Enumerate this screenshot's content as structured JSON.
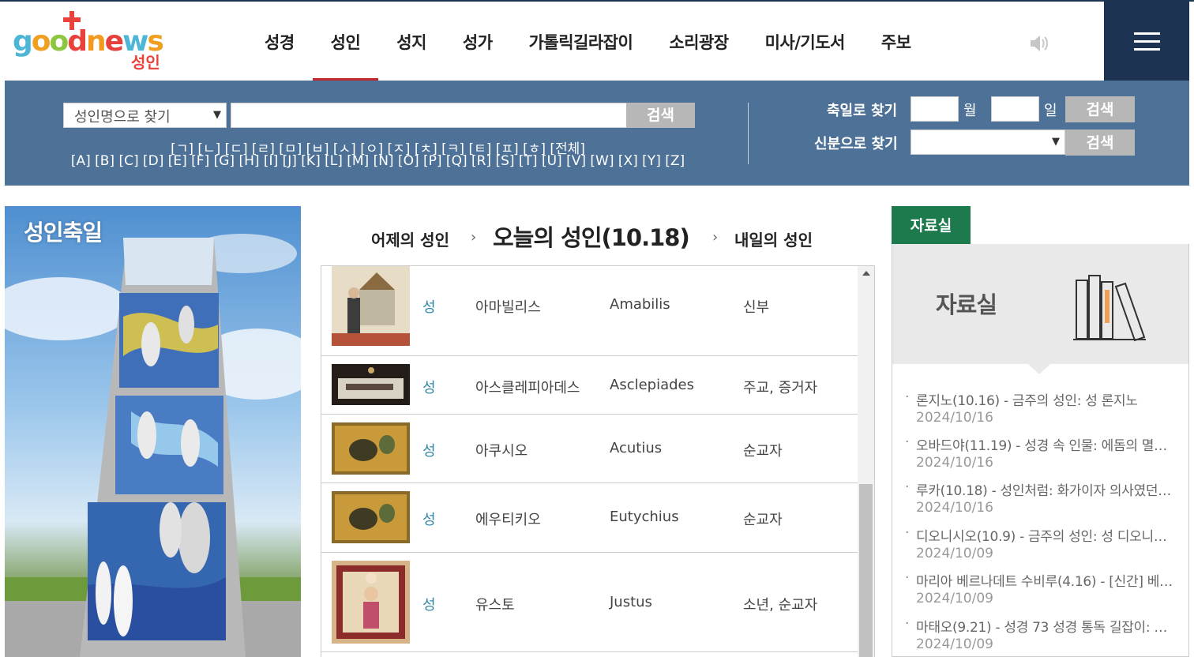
{
  "header": {
    "logo_text": "goodnews",
    "logo_sub": "성인",
    "nav": [
      {
        "label": "성경",
        "active": false
      },
      {
        "label": "성인",
        "active": true
      },
      {
        "label": "성지",
        "active": false
      },
      {
        "label": "성가",
        "active": false
      },
      {
        "label": "가톨릭길라잡이",
        "active": false
      },
      {
        "label": "소리광장",
        "active": false
      },
      {
        "label": "미사/기도서",
        "active": false
      },
      {
        "label": "주보",
        "active": false
      }
    ]
  },
  "search": {
    "select_value": "성인명으로 찾기",
    "button": "검색",
    "consonants": "[ㄱ] [ㄴ] [ㄷ] [ㄹ] [ㅁ] [ㅂ] [ㅅ] [ㅇ] [ㅈ] [ㅊ] [ㅋ] [ㅌ] [ㅍ] [ㅎ] [전체]",
    "alphabet": "[A] [B] [C] [D] [E] [F] [G] [H] [I] [J] [K] [L] [M] [N] [O] [P] [Q] [R] [S] [T] [U] [V] [W] [X] [Y] [Z]",
    "feast_label": "축일로 찾기",
    "month_label": "월",
    "day_label": "일",
    "feast_button": "검색",
    "status_label": "신분으로 찾기",
    "status_button": "검색"
  },
  "feature": {
    "title": "성인축일"
  },
  "day_nav": {
    "prev": "어제의 성인",
    "current": "오늘의 성인(10.18)",
    "next": "내일의 성인"
  },
  "saints": [
    {
      "prefix": "성",
      "name_ko": "아마빌리스",
      "name_en": "Amabilis",
      "role": "신부"
    },
    {
      "prefix": "성",
      "name_ko": "아스클레피아데스",
      "name_en": "Asclepiades",
      "role": "주교, 증거자"
    },
    {
      "prefix": "성",
      "name_ko": "아쿠시오",
      "name_en": "Acutius",
      "role": "순교자"
    },
    {
      "prefix": "성",
      "name_ko": "에우티키오",
      "name_en": "Eutychius",
      "role": "순교자"
    },
    {
      "prefix": "성",
      "name_ko": "유스토",
      "name_en": "Justus",
      "role": "소년, 순교자"
    }
  ],
  "sidebar": {
    "tab": "자료실",
    "banner_title": "자료실",
    "news": [
      {
        "title": "론지노(10.16) - 금주의 성인: 성 론지노",
        "date": "2024/10/16"
      },
      {
        "title": "오바드야(11.19) - 성경 속 인물: 에돔의 멸…",
        "date": "2024/10/16"
      },
      {
        "title": "루카(10.18) - 성인처럼: 화가이자 의사였던…",
        "date": "2024/10/16"
      },
      {
        "title": "디오니시오(10.9) - 금주의 성인: 성 디오니…",
        "date": "2024/10/09"
      },
      {
        "title": "마리아 베르나데트 수비루(4.16) - [신간] 베…",
        "date": "2024/10/09"
      },
      {
        "title": "마태오(9.21) - 성경 73 성경 통독 길잡이: …",
        "date": "2024/10/09"
      }
    ]
  },
  "colors": {
    "header_dark": "#1c3351",
    "search_bg": "#4e7297",
    "active_underline": "#c0272d",
    "sidebar_tab": "#1c7a4d",
    "saint_prefix": "#2f86a8"
  }
}
